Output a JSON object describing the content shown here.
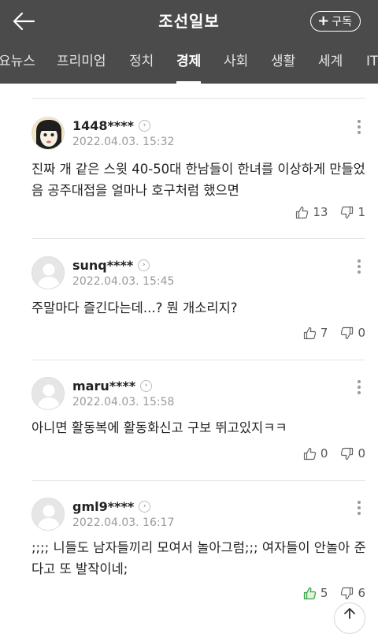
{
  "header": {
    "title": "조선일보",
    "back_icon": "arrow-left-icon",
    "subscribe_label": "구독",
    "subscribe_icon": "plus-icon"
  },
  "tabs": [
    {
      "label": "요뉴스",
      "active": false
    },
    {
      "label": "프리미엄",
      "active": false
    },
    {
      "label": "정치",
      "active": false
    },
    {
      "label": "경제",
      "active": true
    },
    {
      "label": "사회",
      "active": false
    },
    {
      "label": "생활",
      "active": false
    },
    {
      "label": "세계",
      "active": false
    },
    {
      "label": "IT",
      "active": false
    }
  ],
  "comments": [
    {
      "user": "1448****",
      "date": "2022.04.03. 15:32",
      "text": "진짜 개 같은 스윗 40-50대 한남들이 한녀를 이상하게 만들었음 공주대접을 얼마나 호구처럼 했으면",
      "likes": "13",
      "dislikes": "1",
      "avatar": "cartoon-avatar"
    },
    {
      "user": "sunq****",
      "date": "2022.04.03. 15:45",
      "text": "주말마다 즐긴다는데...? 뭔 개소리지?",
      "likes": "7",
      "dislikes": "0",
      "avatar": "default-avatar"
    },
    {
      "user": "maru****",
      "date": "2022.04.03. 15:58",
      "text": "아니면 활동복에 활동화신고 구보 뛰고있지ㅋㅋ",
      "likes": "0",
      "dislikes": "0",
      "avatar": "default-avatar"
    },
    {
      "user": "gml9****",
      "date": "2022.04.03. 16:17",
      "text": ";;;; 니들도 남자들끼리 모여서 놀아그럼;;; 여자들이 안놀아 준다고 또 발작이네;",
      "likes": "5",
      "dislikes": "6",
      "avatar": "default-avatar"
    }
  ],
  "colors": {
    "header_bg": "#4b4b4b",
    "liked_green": "#3aa34a"
  },
  "scroll_top_icon": "arrow-up-icon"
}
